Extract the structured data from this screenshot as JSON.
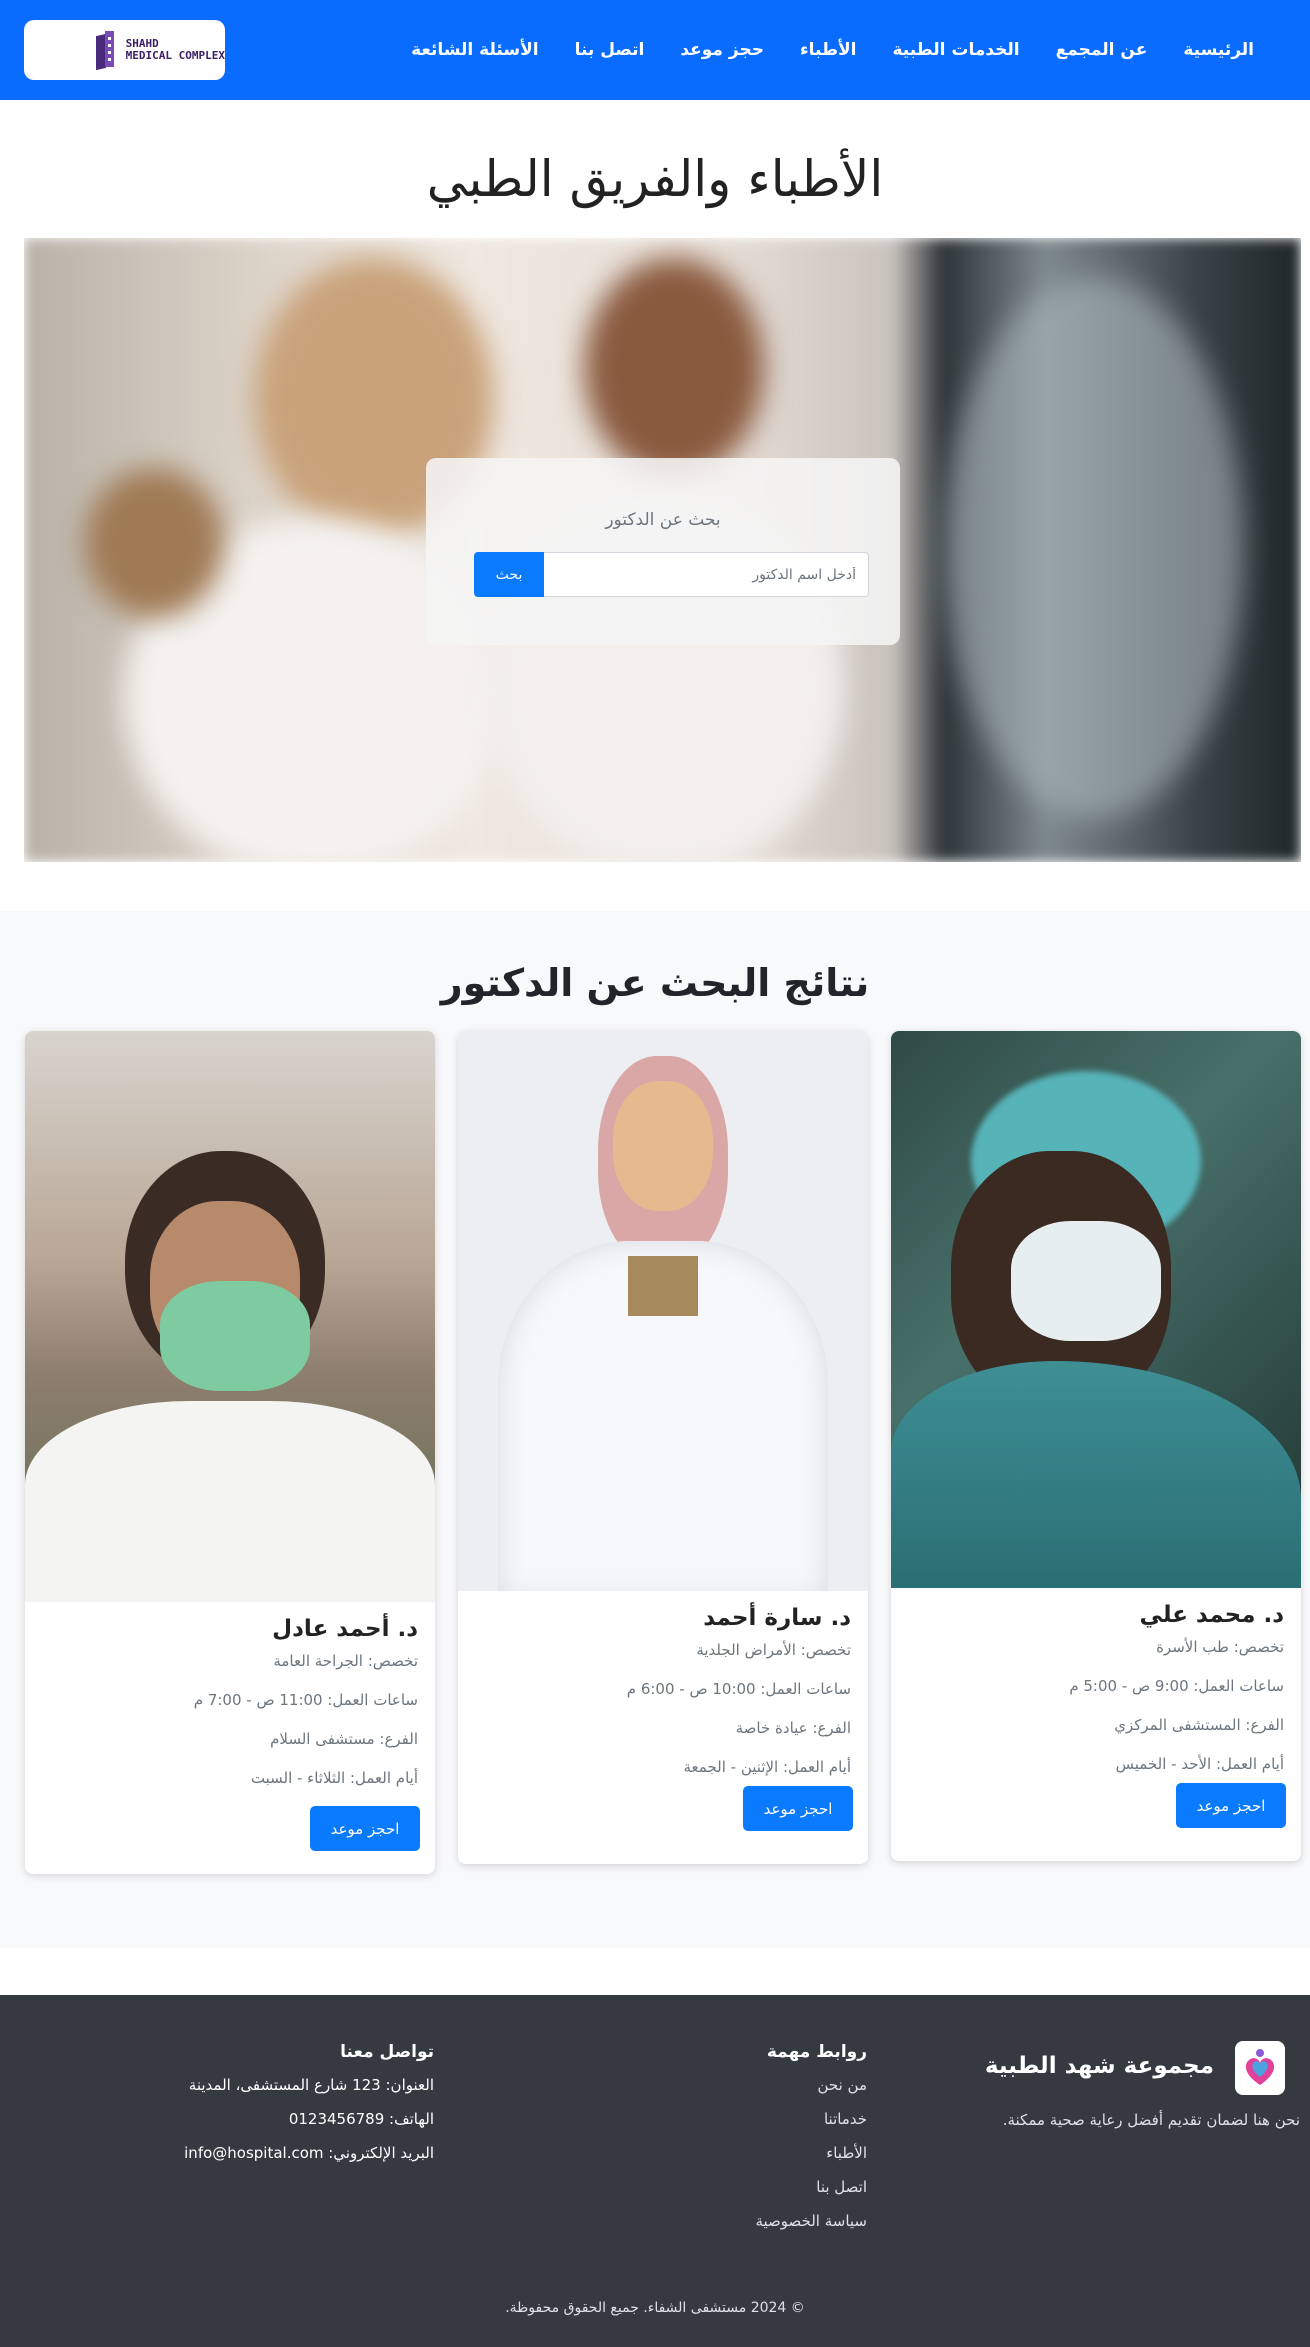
{
  "navbar": {
    "brand_line1": "SHAHD",
    "brand_line2": "MEDICAL COMPLEX",
    "links": [
      "الرئيسية",
      "عن المجمع",
      "الخدمات الطبية",
      "الأطباء",
      "حجز موعد",
      "اتصل بنا",
      "الأسئلة الشائعة"
    ]
  },
  "hero": {
    "title": "الأطباء والفريق الطبي",
    "search_label": "بحث عن الدكتور",
    "search_placeholder": "أدخل اسم الدكتور",
    "search_button": "بحث"
  },
  "results": {
    "title": "نتائج البحث عن الدكتور",
    "doctors": [
      {
        "name": "د. محمد علي",
        "specialty": "تخصص: طب الأسرة",
        "hours": "ساعات العمل: 9:00 ص - 5:00 م",
        "branch": "الفرع: المستشفى المركزي",
        "days": "أيام العمل: الأحد - الخميس",
        "button": "احجز موعد"
      },
      {
        "name": "د. سارة أحمد",
        "specialty": "تخصص: الأمراض الجلدية",
        "hours": "ساعات العمل: 10:00 ص - 6:00 م",
        "branch": "الفرع: عيادة خاصة",
        "days": "أيام العمل: الإثنين - الجمعة",
        "button": "احجز موعد"
      },
      {
        "name": "د. أحمد عادل",
        "specialty": "تخصص: الجراحة العامة",
        "hours": "ساعات العمل: 11:00 ص - 7:00 م",
        "branch": "الفرع: مستشفى السلام",
        "days": "أيام العمل: الثلاثاء - السبت",
        "button": "احجز موعد"
      }
    ]
  },
  "footer": {
    "brand": "مجموعة شهد الطبية",
    "description": "نحن هنا لضمان تقديم أفضل رعاية صحية ممكنة.",
    "links_title": "روابط مهمة",
    "links": [
      "من نحن",
      "خدماتنا",
      "الأطباء",
      "اتصل بنا",
      "سياسة الخصوصية"
    ],
    "contact_title": "تواصل معنا",
    "address": "العنوان: 123 شارع المستشفى، المدينة",
    "phone": "الهاتف: 0123456789",
    "email": "البريد الإلكتروني: info@hospital.com",
    "copyright": "© 2024 مستشفى الشفاء. جميع الحقوق محفوظة."
  },
  "colors": {
    "primary": "#0a6cff",
    "footer_bg": "#343a40",
    "section_bg": "#f8f9fa"
  }
}
